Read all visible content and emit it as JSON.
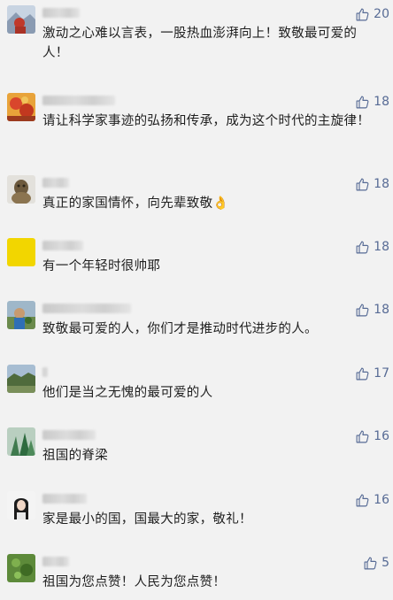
{
  "accent_color": "#576b95",
  "like_icon": "thumbs-up-outline-icon",
  "comments": [
    {
      "text": "激动之心难以言表，一股热血澎湃向上！致敬最可爱的人！",
      "likes": "20"
    },
    {
      "text": "请让科学家事迹的弘扬和传承，成为这个时代的主旋律！",
      "likes": "18"
    },
    {
      "text": "真正的家国情怀，向先辈致敬👌",
      "likes": "18"
    },
    {
      "text": "有一个年轻时很帅耶",
      "likes": "18"
    },
    {
      "text": "致敬最可爱的人，你们才是推动时代进步的人。",
      "likes": "18"
    },
    {
      "text": "他们是当之无愧的最可爱的人",
      "likes": "17"
    },
    {
      "text": "祖国的脊梁",
      "likes": "16"
    },
    {
      "text": "家是最小的国，国最大的家，敬礼！",
      "likes": "16"
    },
    {
      "text": "祖国为您点赞！人民为您点赞！",
      "likes": "5"
    }
  ]
}
